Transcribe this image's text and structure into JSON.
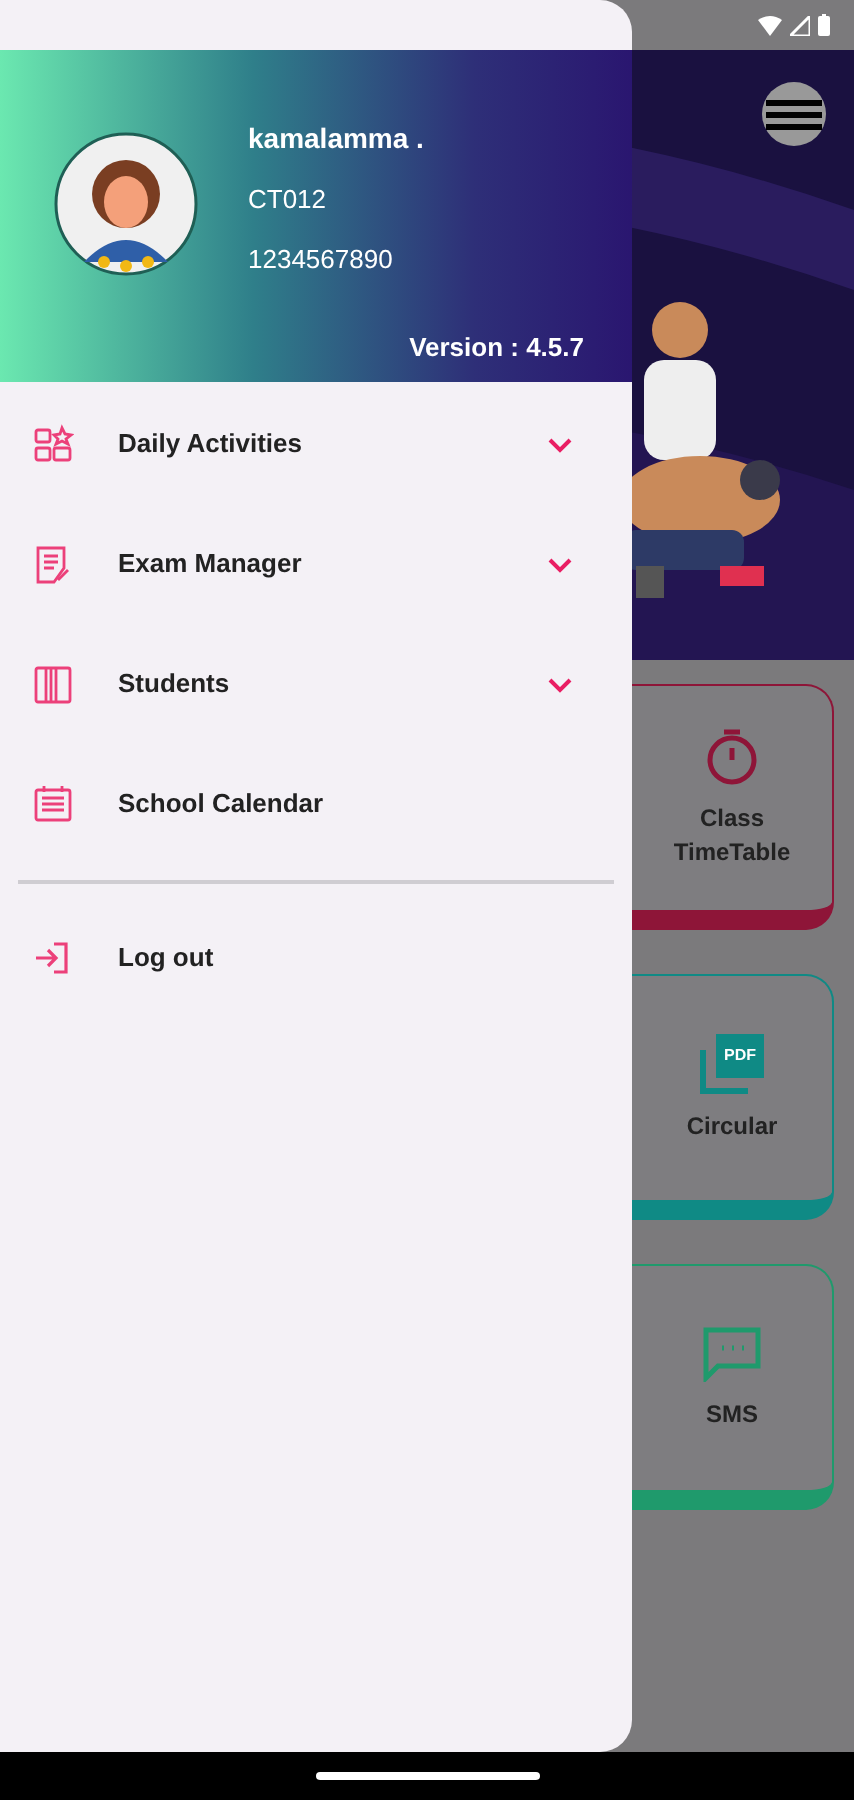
{
  "drawer": {
    "profile": {
      "name": "kamalamma .",
      "code": "CT012",
      "phone": "1234567890",
      "version": "Version : 4.5.7"
    },
    "menu": [
      {
        "label": "Daily Activities",
        "kind": "expandable",
        "expanded": false
      },
      {
        "label": "Exam Manager",
        "kind": "expandable",
        "expanded": false
      },
      {
        "label": "Students",
        "kind": "expandable",
        "expanded": false
      },
      {
        "label": "School Calendar",
        "kind": "link"
      }
    ],
    "logout": {
      "label": "Log out"
    }
  },
  "background": {
    "cards": [
      {
        "label": "Class TimeTable",
        "color": "#8e1538"
      },
      {
        "label": "Circular",
        "color": "#0f8a85",
        "icon_text": "PDF"
      },
      {
        "label": "SMS",
        "color": "#1f9a6c"
      }
    ]
  }
}
